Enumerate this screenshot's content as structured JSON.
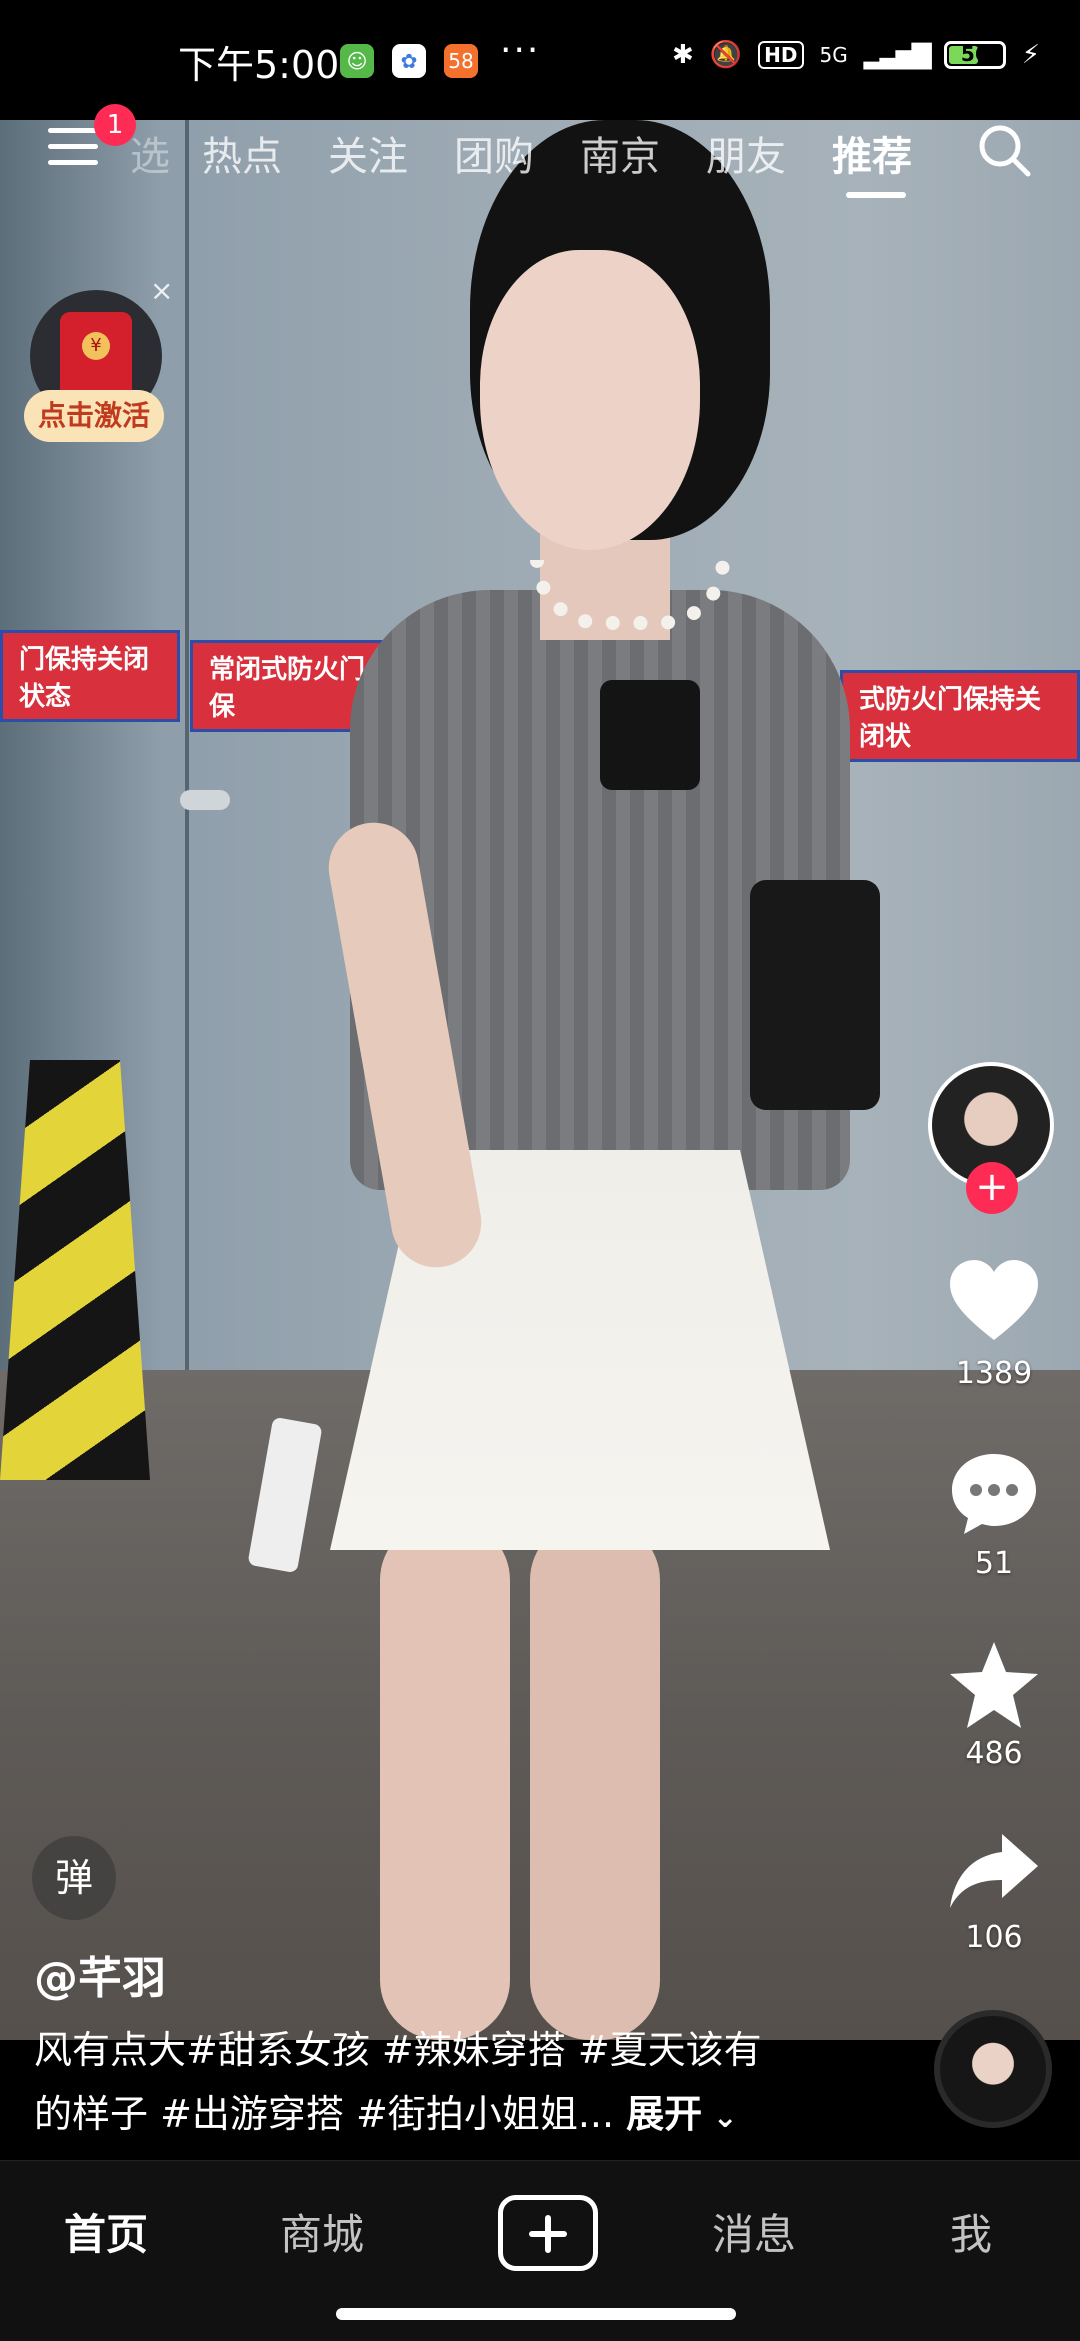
{
  "status_bar": {
    "time": "下午5:00",
    "network": "5G",
    "battery_level": "56",
    "battery_percent": 56,
    "icons": [
      "app-icon-1",
      "app-icon-2",
      "app-icon-58",
      "more-dots",
      "bluetooth-icon",
      "mute-icon",
      "hd-icon",
      "signal-icon",
      "battery-icon",
      "charging-icon"
    ]
  },
  "top_nav": {
    "menu_badge": "1",
    "partial_tab": "选",
    "tabs": [
      {
        "label": "热点",
        "active": false
      },
      {
        "label": "关注",
        "active": false
      },
      {
        "label": "团购",
        "active": false
      },
      {
        "label": "南京",
        "active": false
      },
      {
        "label": "朋友",
        "active": false
      },
      {
        "label": "推荐",
        "active": true
      }
    ]
  },
  "red_packet": {
    "label": "点击激活",
    "close": "×",
    "coin": "¥"
  },
  "video": {
    "sign_left": "门保持关闭状态",
    "sign_mid": "常闭式防火门保",
    "sign_right": "式防火门保持关闭状"
  },
  "actions": {
    "follow": "+",
    "likes": "1389",
    "comments": "51",
    "favorites": "486",
    "shares": "106"
  },
  "post": {
    "danmaku_label": "弹",
    "author": "@芊羽",
    "caption_line1": "风有点大#甜系女孩 #辣妹穿搭 #夏天该有",
    "caption_line2": "的样子 #出游穿搭 #街拍小姐姐...",
    "expand_label": "展开"
  },
  "tab_bar": {
    "items": [
      {
        "label": "首页",
        "active": true
      },
      {
        "label": "商城",
        "active": false
      },
      {
        "label": "消息",
        "active": false
      },
      {
        "label": "我",
        "active": false
      }
    ]
  },
  "colors": {
    "accent": "#fe2c55",
    "background": "#000000"
  }
}
